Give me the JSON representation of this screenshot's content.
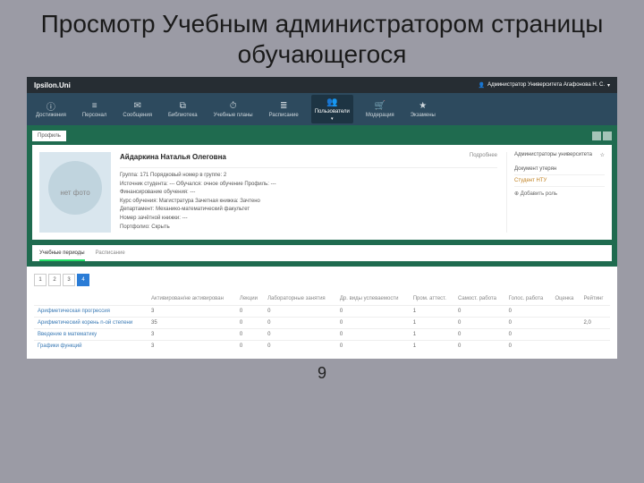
{
  "slide": {
    "title": "Просмотр Учебным администратором страницы обучающегося",
    "page_number": "9"
  },
  "header": {
    "brand": "Ipsilon.Uni",
    "user_role": "Администратор Университета Агафонова Н. С."
  },
  "nav": {
    "items": [
      {
        "icon": "ⓘ",
        "label": "Достижения"
      },
      {
        "icon": "≡",
        "label": "Персонал"
      },
      {
        "icon": "✉",
        "label": "Сообщения"
      },
      {
        "icon": "⧉",
        "label": "Библиотека"
      },
      {
        "icon": "⏱",
        "label": "Учебные планы"
      },
      {
        "icon": "≣",
        "label": "Расписание"
      },
      {
        "icon": "👥",
        "label": "Пользователи"
      },
      {
        "icon": "🛒",
        "label": "Модерация"
      },
      {
        "icon": "★",
        "label": "Экзамены"
      }
    ],
    "active_index": 6
  },
  "breadcrumb": "Профиль",
  "profile": {
    "photo_label": "нет фото",
    "name": "Айдаркина Наталья Олеговна",
    "more": "Подробнее",
    "lines": [
      "Группа: 171   Порядковый номер в группе: 2",
      "Источник студента: ---   Обучался: очное обучение   Профиль: ---",
      "Финансирование обучения: ---",
      "Курс обучения: Магистратура   Зачетная книжка: Зачтено",
      "Департамент: Механико-математический факультет",
      "Номер зачётной книжки: ---",
      "Портфолио: Скрыть"
    ]
  },
  "roles": {
    "heading": "Администраторы университета",
    "star": "☆",
    "items": [
      {
        "text": "Документ утерян",
        "warn": false
      },
      {
        "text": "Студент НТУ",
        "warn": true
      }
    ],
    "add": "⊕ Добавить роль"
  },
  "tabs": {
    "items": [
      "Учебные периоды",
      "Расписание"
    ],
    "active_index": 0
  },
  "pager": {
    "pages": [
      "1",
      "2",
      "3",
      "4"
    ],
    "active_index": 3
  },
  "table": {
    "headers": [
      "",
      "Активирован/не активирован",
      "Лекции",
      "Лабораторные занятия",
      "Др. виды успеваемости",
      "Пром. аттест.",
      "Самост. работа",
      "Голос. работа",
      "Оценка",
      "Рейтинг"
    ],
    "rows": [
      [
        "Арифметическая прогрессия",
        "3",
        "0",
        "0",
        "0",
        "1",
        "0",
        "0",
        "",
        ""
      ],
      [
        "Арифметический корень n-ой степени",
        "35",
        "0",
        "0",
        "0",
        "1",
        "0",
        "0",
        "",
        "2,0"
      ],
      [
        "Введение в математику",
        "3",
        "0",
        "0",
        "0",
        "1",
        "0",
        "0",
        "",
        ""
      ],
      [
        "Графики функций",
        "3",
        "0",
        "0",
        "0",
        "1",
        "0",
        "0",
        "",
        ""
      ]
    ]
  }
}
